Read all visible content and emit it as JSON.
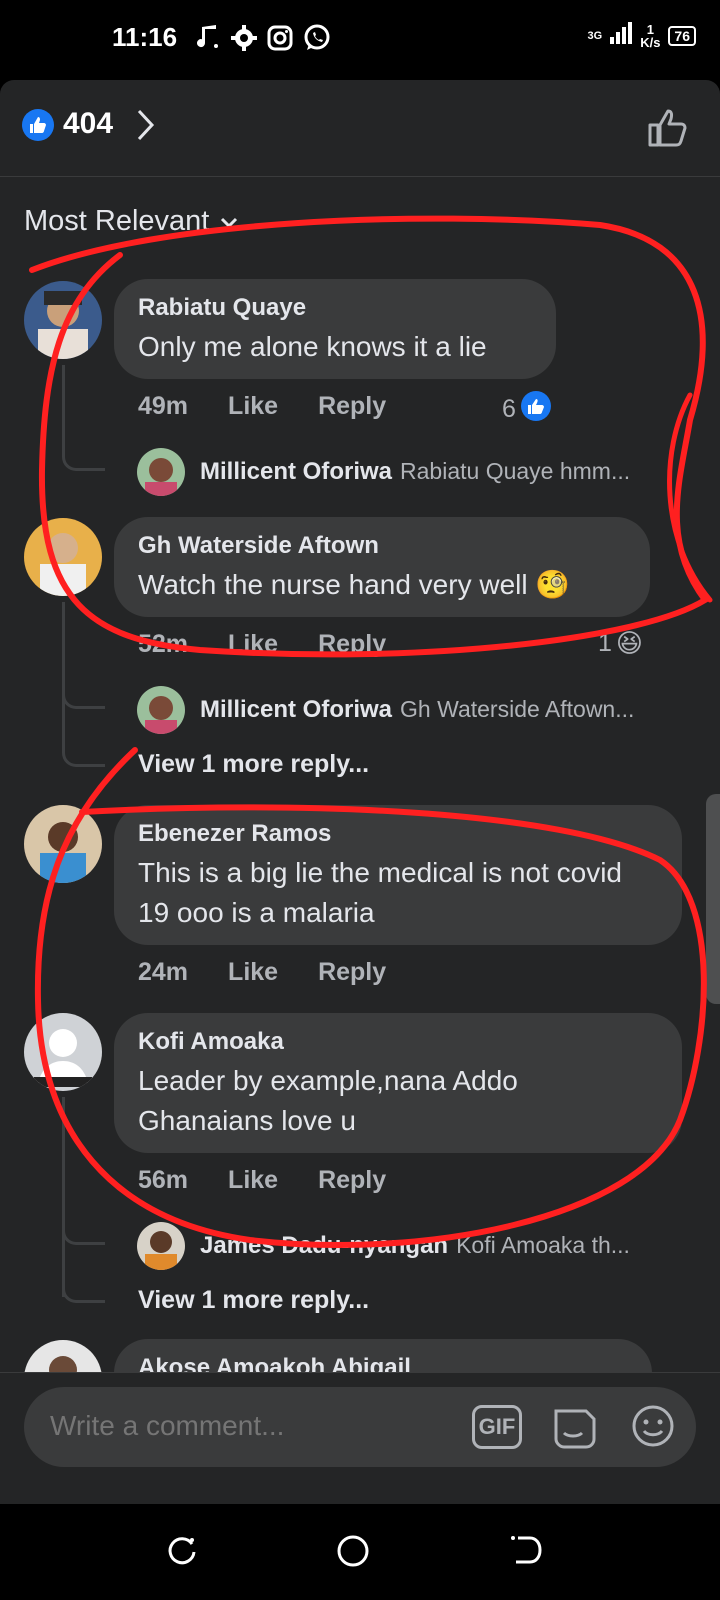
{
  "status": {
    "time": "11:16",
    "network": "3G",
    "speed_value": "1",
    "speed_unit": "K/s",
    "battery": "76"
  },
  "header": {
    "reaction_count": "404"
  },
  "sort": {
    "label": "Most Relevant"
  },
  "comments": [
    {
      "name": "Rabiatu Quaye",
      "text": "Only me alone knows it a lie",
      "time": "49m",
      "like": "Like",
      "reply": "Reply",
      "reactions": "6"
    },
    {
      "name": "Gh Waterside Aftown",
      "text": "Watch the nurse hand very well",
      "emoji": "🧐",
      "time": "52m",
      "like": "Like",
      "reply": "Reply",
      "reactions": "1",
      "reaction_emoji": "😆"
    },
    {
      "name": "Ebenezer Ramos",
      "text": "This is a big lie the medical is not covid 19 ooo is a malaria",
      "time": "24m",
      "like": "Like",
      "reply": "Reply"
    },
    {
      "name": "Kofi Amoaka",
      "text": "Leader by example,nana Addo Ghanaians love u",
      "time": "56m",
      "like": "Like",
      "reply": "Reply"
    },
    {
      "name": "Akose Amoakoh Abigail"
    }
  ],
  "replies": [
    {
      "name": "Millicent Oforiwa",
      "preview": "Rabiatu Quaye hmm..."
    },
    {
      "name": "Millicent Oforiwa",
      "preview": "Gh Waterside Aftown..."
    },
    {
      "name": "James Dadu-nyangan",
      "preview": "Kofi Amoaka th..."
    }
  ],
  "view_more": [
    "View 1 more reply...",
    "View 1 more reply..."
  ],
  "composer": {
    "placeholder": "Write a comment...",
    "gif_label": "GIF"
  },
  "colors": {
    "background": "#242526",
    "bubble": "#3a3b3c",
    "accent": "#1877f2",
    "annotation": "#ff2020"
  }
}
